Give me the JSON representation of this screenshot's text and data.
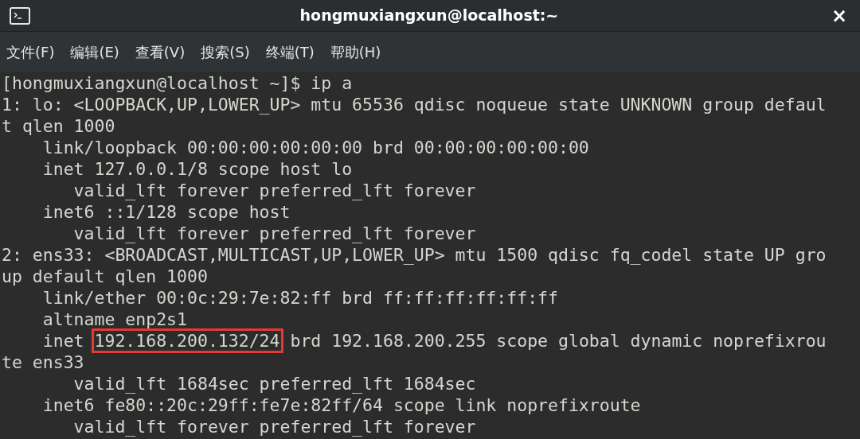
{
  "window": {
    "title": "hongmuxiangxun@localhost:~",
    "close": "×"
  },
  "menu": [
    "文件(F)",
    "编辑(E)",
    "查看(V)",
    "搜索(S)",
    "终端(T)",
    "帮助(H)"
  ],
  "terminal": {
    "lines": [
      {
        "segments": [
          {
            "text": "[hongmuxiangxun@localhost ~]$ ip a",
            "highlighted": false
          }
        ]
      },
      {
        "segments": [
          {
            "text": "1: lo: <LOOPBACK,UP,LOWER_UP> mtu 65536 qdisc noqueue state UNKNOWN group defaul",
            "highlighted": false
          }
        ]
      },
      {
        "segments": [
          {
            "text": "t qlen 1000",
            "highlighted": false
          }
        ]
      },
      {
        "segments": [
          {
            "text": "    link/loopback 00:00:00:00:00:00 brd 00:00:00:00:00:00",
            "highlighted": false
          }
        ]
      },
      {
        "segments": [
          {
            "text": "    inet 127.0.0.1/8 scope host lo",
            "highlighted": false
          }
        ]
      },
      {
        "segments": [
          {
            "text": "       valid_lft forever preferred_lft forever",
            "highlighted": false
          }
        ]
      },
      {
        "segments": [
          {
            "text": "    inet6 ::1/128 scope host",
            "highlighted": false
          }
        ]
      },
      {
        "segments": [
          {
            "text": "       valid_lft forever preferred_lft forever",
            "highlighted": false
          }
        ]
      },
      {
        "segments": [
          {
            "text": "2: ens33: <BROADCAST,MULTICAST,UP,LOWER_UP> mtu 1500 qdisc fq_codel state UP gro",
            "highlighted": false
          }
        ]
      },
      {
        "segments": [
          {
            "text": "up default qlen 1000",
            "highlighted": false
          }
        ]
      },
      {
        "segments": [
          {
            "text": "    link/ether 00:0c:29:7e:82:ff brd ff:ff:ff:ff:ff:ff",
            "highlighted": false
          }
        ]
      },
      {
        "segments": [
          {
            "text": "    altname enp2s1",
            "highlighted": false
          }
        ]
      },
      {
        "segments": [
          {
            "text": "    inet ",
            "highlighted": false
          },
          {
            "text": "192.168.200.132/24",
            "highlighted": true
          },
          {
            "text": " brd 192.168.200.255 scope global dynamic noprefixrou",
            "highlighted": false
          }
        ]
      },
      {
        "segments": [
          {
            "text": "te ens33",
            "highlighted": false
          }
        ]
      },
      {
        "segments": [
          {
            "text": "       valid_lft 1684sec preferred_lft 1684sec",
            "highlighted": false
          }
        ]
      },
      {
        "segments": [
          {
            "text": "    inet6 fe80::20c:29ff:fe7e:82ff/64 scope link noprefixroute",
            "highlighted": false
          }
        ]
      },
      {
        "segments": [
          {
            "text": "       valid_lft forever preferred_lft forever",
            "highlighted": false
          }
        ]
      }
    ]
  }
}
